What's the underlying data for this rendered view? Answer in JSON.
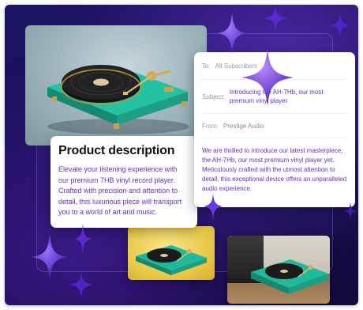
{
  "description": {
    "title": "Product description",
    "body": "Elevate your listening experience with our premium 7HB vinyl record player. Crafted with precision and attention to detail, this luxurious piece will transport you to a world of art and music."
  },
  "email": {
    "to_label": "To:",
    "to_value": "All Subscribers",
    "subject_label": "Subject:",
    "subject_value": "Introducing the AH-7Hb, our most premium vinyl player",
    "from_label": "From:",
    "from_value": "Prestige Audio",
    "body": "We are thrilled to introduce our latest masterpiece, the AH-7Hb, our most premium vinyl player yet. Meticulously crafted with the utmost attention to detail, this exceptional device offers an unparalleled audio experience."
  },
  "icons": [
    "sparkle-star-icon",
    "turntable-image"
  ],
  "colors": {
    "background": "#1a0f55",
    "accent_text": "#6a2fc2",
    "turntable_base": "#1fa88c",
    "star": "#6a36e6"
  }
}
